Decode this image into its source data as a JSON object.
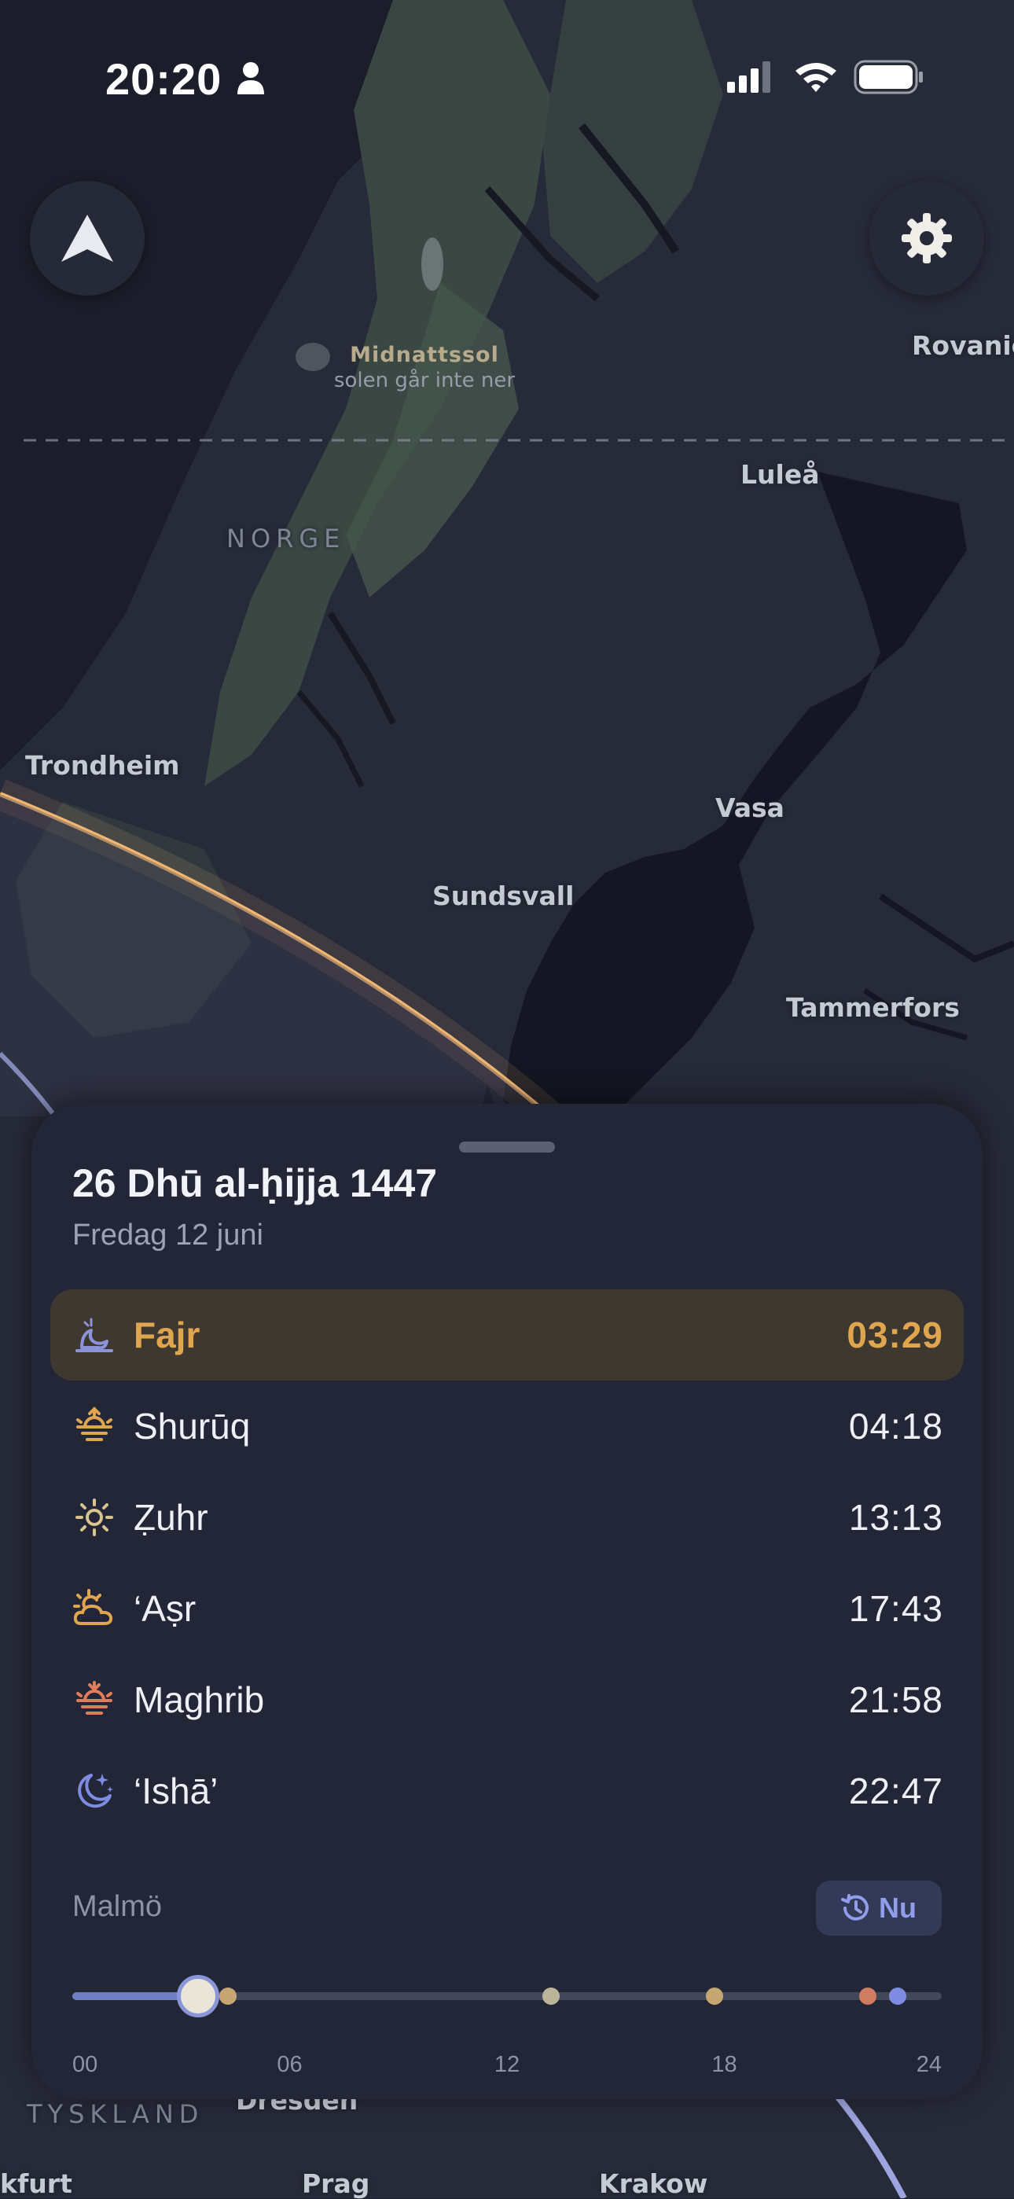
{
  "status_bar": {
    "time": "20:20"
  },
  "map": {
    "midnight_sun": {
      "title": "Midnattssol",
      "subtitle": "solen går inte ner"
    },
    "labels": {
      "rovaniemi": "Rovanie",
      "lulea": "Luleå",
      "norge": "NORGE",
      "trondheim": "Trondheim",
      "vasa": "Vasa",
      "sundsvall": "Sundsvall",
      "tammerfors": "Tammerfors",
      "tyskland": "TYSKLAND",
      "dresden": "Dresden",
      "frankfurt": "kfurt",
      "prag": "Prag",
      "krakow": "Krakow"
    }
  },
  "sheet": {
    "hijri_date": "26 Dhū al-ḥijja 1447",
    "gregorian_date": "Fredag 12 juni",
    "prayers": [
      {
        "name": "Fajr",
        "time": "03:29",
        "icon": "fajr-icon",
        "color": "#8d93d8",
        "active": true
      },
      {
        "name": "Shurūq",
        "time": "04:18",
        "icon": "sunrise-icon",
        "color": "#e0a64f",
        "active": false
      },
      {
        "name": "Ẓuhr",
        "time": "13:13",
        "icon": "sun-icon",
        "color": "#d9c38f",
        "active": false
      },
      {
        "name": "‘Aṣr",
        "time": "17:43",
        "icon": "sun-cloud-icon",
        "color": "#e0a64f",
        "active": false
      },
      {
        "name": "Maghrib",
        "time": "21:58",
        "icon": "sunset-icon",
        "color": "#e07e5c",
        "active": false
      },
      {
        "name": "‘Ishā’",
        "time": "22:47",
        "icon": "moon-stars-icon",
        "color": "#7d8ce0",
        "active": false
      }
    ],
    "city": "Malmö",
    "now_button": "Nu",
    "timeline": {
      "ticks": [
        "00",
        "06",
        "12",
        "18",
        "24"
      ],
      "current_hour": 3.48,
      "markers": [
        {
          "hour": 4.3,
          "color": "#c6a774"
        },
        {
          "hour": 13.22,
          "color": "#bcb49a"
        },
        {
          "hour": 17.72,
          "color": "#c6a774"
        },
        {
          "hour": 21.97,
          "color": "#d07c62"
        },
        {
          "hour": 22.78,
          "color": "#7d8ce0"
        }
      ]
    }
  },
  "colors": {
    "accent_gold": "#e0a64f",
    "accent_blue": "#8f9dea",
    "sheet_bg": "#232637"
  }
}
